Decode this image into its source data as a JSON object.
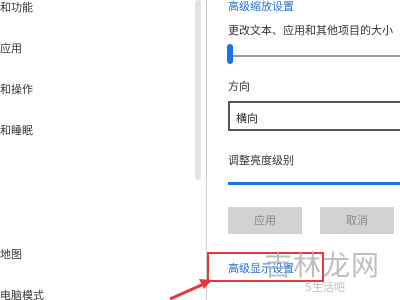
{
  "sidebar": {
    "items": [
      {
        "label": "和功能"
      },
      {
        "label": "应用"
      },
      {
        "label": "和操作"
      },
      {
        "label": "和睡眠"
      },
      {
        "label": "地图"
      },
      {
        "label": "电脑模式"
      }
    ]
  },
  "display": {
    "top_link": "高级缩放设置",
    "size_label": "更改文本、应用和其他项目的大小",
    "orientation_label": "方向",
    "orientation_value": "横向",
    "brightness_label": "调整亮度级别",
    "apply_label": "应用",
    "cancel_label": "取消",
    "advanced_link": "高级显示设置"
  },
  "watermark": {
    "main": "吉林龙网",
    "sub": "5生活吧"
  },
  "colors": {
    "accent": "#1a73e8",
    "link": "#1e6fd9",
    "highlight": "#e5363a",
    "button_bg": "#d2d2d2"
  }
}
